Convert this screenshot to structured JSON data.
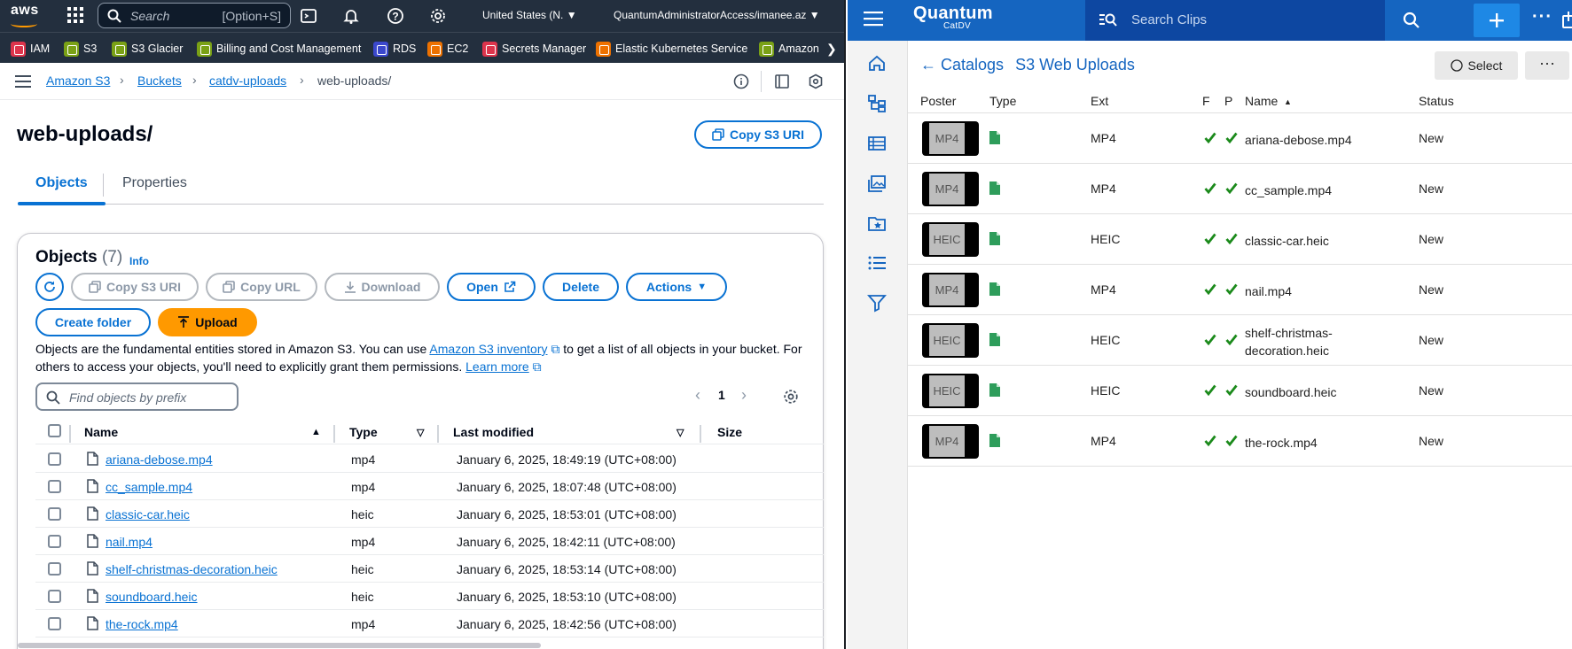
{
  "aws": {
    "logo": "aws",
    "search": {
      "placeholder": "Search",
      "shortcut": "[Option+S]"
    },
    "region": "United States (N.",
    "account": "QuantumAdministratorAccess/imanee.az",
    "favorites": [
      "IAM",
      "S3",
      "S3 Glacier",
      "Billing and Cost Management",
      "RDS",
      "EC2",
      "Secrets Manager",
      "Elastic Kubernetes Service",
      "Amazon"
    ],
    "favorite_colors": [
      "#dd344c",
      "#7aa116",
      "#7aa116",
      "#7aa116",
      "#3b48cc",
      "#ed7100",
      "#dd344c",
      "#ed7100",
      "#7aa116"
    ],
    "breadcrumb": [
      "Amazon S3",
      "Buckets",
      "catdv-uploads",
      "web-uploads/"
    ],
    "title": "web-uploads/",
    "copy_s3_uri_top": "Copy S3 URI",
    "tabs": [
      "Objects",
      "Properties"
    ],
    "objects_heading": "Objects",
    "objects_count": "(7)",
    "info": "Info",
    "actions": {
      "copy_s3_uri": "Copy S3 URI",
      "copy_url": "Copy URL",
      "download": "Download",
      "open": "Open",
      "delete": "Delete",
      "actions": "Actions",
      "create_folder": "Create folder",
      "upload": "Upload"
    },
    "description": {
      "part1": "Objects are the fundamental entities stored in Amazon S3. You can use ",
      "link1": "Amazon S3 inventory",
      "part2": " to get a list of all objects in your bucket. For others to access your objects, you'll need to explicitly grant them permissions. ",
      "link2": "Learn more"
    },
    "find_placeholder": "Find objects by prefix",
    "page": "1",
    "columns": [
      "Name",
      "Type",
      "Last modified",
      "Size"
    ],
    "rows": [
      {
        "name": "ariana-debose.mp4",
        "type": "mp4",
        "modified": "January 6, 2025, 18:49:19 (UTC+08:00)"
      },
      {
        "name": "cc_sample.mp4",
        "type": "mp4",
        "modified": "January 6, 2025, 18:07:48 (UTC+08:00)"
      },
      {
        "name": "classic-car.heic",
        "type": "heic",
        "modified": "January 6, 2025, 18:53:01 (UTC+08:00)"
      },
      {
        "name": "nail.mp4",
        "type": "mp4",
        "modified": "January 6, 2025, 18:42:11 (UTC+08:00)"
      },
      {
        "name": "shelf-christmas-decoration.heic",
        "type": "heic",
        "modified": "January 6, 2025, 18:53:14 (UTC+08:00)"
      },
      {
        "name": "soundboard.heic",
        "type": "heic",
        "modified": "January 6, 2025, 18:53:10 (UTC+08:00)"
      },
      {
        "name": "the-rock.mp4",
        "type": "mp4",
        "modified": "January 6, 2025, 18:42:56 (UTC+08:00)"
      }
    ]
  },
  "catdv": {
    "logo": "Quantum",
    "logo_sub": "CatDV",
    "search_placeholder": "Search Clips",
    "breadcrumb_back": "Catalogs",
    "breadcrumb_current": "S3 Web Uploads",
    "select_label": "Select",
    "more_label": "···",
    "columns": [
      "Poster",
      "Type",
      "Ext",
      "F",
      "P",
      "Name",
      "Status"
    ],
    "rows": [
      {
        "poster": "MP4",
        "ext": "MP4",
        "name": "ariana-debose.mp4",
        "status": "New"
      },
      {
        "poster": "MP4",
        "ext": "MP4",
        "name": "cc_sample.mp4",
        "status": "New"
      },
      {
        "poster": "HEIC",
        "ext": "HEIC",
        "name": "classic-car.heic",
        "status": "New"
      },
      {
        "poster": "MP4",
        "ext": "MP4",
        "name": "nail.mp4",
        "status": "New"
      },
      {
        "poster": "HEIC",
        "ext": "HEIC",
        "name": "shelf-christmas-decoration.heic",
        "status": "New"
      },
      {
        "poster": "HEIC",
        "ext": "HEIC",
        "name": "soundboard.heic",
        "status": "New"
      },
      {
        "poster": "MP4",
        "ext": "MP4",
        "name": "the-rock.mp4",
        "status": "New"
      }
    ],
    "accent": "#1565c0",
    "check_color": "#1b8a1b"
  }
}
